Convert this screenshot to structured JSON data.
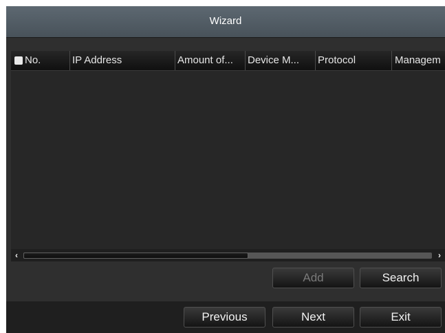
{
  "window": {
    "title": "Wizard"
  },
  "table": {
    "columns": [
      {
        "label": "No."
      },
      {
        "label": "IP Address"
      },
      {
        "label": "Amount of..."
      },
      {
        "label": "Device M..."
      },
      {
        "label": "Protocol"
      },
      {
        "label": "Managem"
      }
    ],
    "rows": [],
    "scroll": {
      "left_arrow": "‹",
      "right_arrow": "›",
      "thumb_position": 0.0,
      "thumb_fraction": 0.55
    }
  },
  "actions": {
    "add_label": "Add",
    "search_label": "Search"
  },
  "footer": {
    "previous_label": "Previous",
    "next_label": "Next",
    "exit_label": "Exit"
  },
  "colors": {
    "title_bar": "#555f67",
    "panel": "#2f2f2f",
    "table_bg": "#272727",
    "footer": "#1f1f1f",
    "disabled_text": "#7a7a7a"
  }
}
